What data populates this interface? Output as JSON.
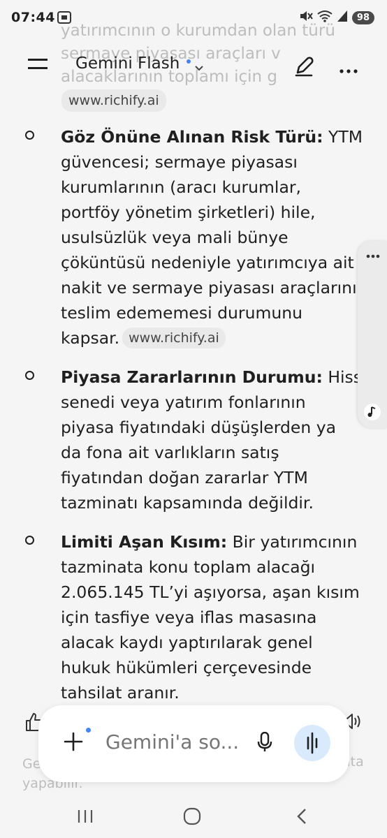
{
  "status_bar": {
    "time": "07:44",
    "battery": "98"
  },
  "faded_text": [
    "yatırımcının o kurumdan olan türü",
    "sermaye piyasası araçları v",
    "alacaklarının toplamı için g"
  ],
  "header": {
    "title": "Gemini Flash"
  },
  "top_chip": "www.richify.ai",
  "items": [
    {
      "title": "Göz Önüne Alınan Risk Türü:",
      "body": " YTM\ngüvencesi; sermaye piyasası\nkurumlarının (aracı kurumlar,\nportföy yönetim şirketleri) hile,\nusulsüzlük veya mali bünye\nçöküntüsü nedeniyle yatırımcıya ait\nnakit ve sermaye piyasası araçlarını\nteslim edememesi durumunu\nkapsar.",
      "chip": "www.richify.ai"
    },
    {
      "title": "Piyasa Zararlarının Durumu:",
      "body": " Hisse\nsenedi veya yatırım fonlarının\npiyasa fiyatındaki düşüşlerden ya\nda fona ait varlıkların satış\nfiyatından doğan zararlar YTM\ntazminatı kapsamında değildir.",
      "chip": ""
    },
    {
      "title": "Limiti Aşan Kısım:",
      "body": " Bir yatırımcının\ntazminata konu toplam alacağı\n2.065.145 TL’yi aşıyorsa, aşan kısım\niçin tasfiye veya iflas masasına\nalacak kaydı yaptırılarak genel\nhukuk hükümleri çerçevesinde\ntahsilat aranır.",
      "chip": ""
    }
  ],
  "input": {
    "placeholder": "Gemini'a so..."
  },
  "footer": {
    "left_text": "Ge\nyapabilir.",
    "right_text": "ata"
  },
  "colors": {
    "accent_blue": "#4285f4",
    "live_button_bg": "#d9eafc"
  }
}
